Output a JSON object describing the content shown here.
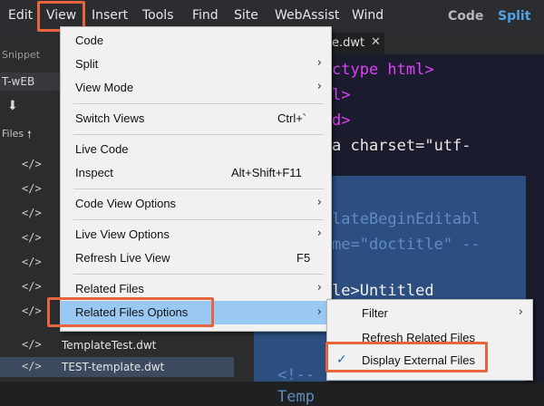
{
  "menubar": {
    "items": [
      "Edit",
      "View",
      "Insert",
      "Tools",
      "Find",
      "Site",
      "WebAssist",
      "Wind"
    ],
    "code": "Code",
    "split": "Split"
  },
  "left_panel": {
    "snippets_tab": "Snippet",
    "site": "T-wEB",
    "files_label": "Files",
    "files": [
      "TemplateTest.dwt",
      "TEST-template.dwt"
    ]
  },
  "editor": {
    "tab": "e.dwt",
    "code_lines": [
      "ctype html>",
      "l>",
      "d>",
      "a charset=\"utf-",
      "lateBeginEditabl",
      "me=\"doctitle\" --",
      "le>Untitled",
      "<!--",
      "Temp"
    ]
  },
  "view_menu": {
    "items": [
      {
        "label": "Code",
        "shortcut": "",
        "arrow": ""
      },
      {
        "label": "Split",
        "shortcut": "",
        "arrow": "›"
      },
      {
        "label": "View Mode",
        "shortcut": "",
        "arrow": "›"
      },
      {
        "label": "Switch Views",
        "shortcut": "Ctrl+`",
        "arrow": ""
      },
      {
        "label": "Live Code",
        "shortcut": "",
        "arrow": ""
      },
      {
        "label": "Inspect",
        "shortcut": "Alt+Shift+F11",
        "arrow": ""
      },
      {
        "label": "Code View Options",
        "shortcut": "",
        "arrow": "›"
      },
      {
        "label": "Live View Options",
        "shortcut": "",
        "arrow": "›"
      },
      {
        "label": "Refresh Live View",
        "shortcut": "F5",
        "arrow": ""
      },
      {
        "label": "Related Files",
        "shortcut": "",
        "arrow": "›"
      },
      {
        "label": "Related Files Options",
        "shortcut": "",
        "arrow": "›"
      }
    ]
  },
  "submenu": {
    "items": [
      {
        "label": "Filter",
        "arrow": "›",
        "checked": ""
      },
      {
        "label": "Refresh Related Files",
        "arrow": "",
        "checked": ""
      },
      {
        "label": "Display External Files",
        "arrow": "",
        "checked": "✓"
      }
    ]
  },
  "colors": {
    "highlight": "#e8643c",
    "selected_row": "#99c9f3",
    "split_accent": "#4ea3e6"
  }
}
